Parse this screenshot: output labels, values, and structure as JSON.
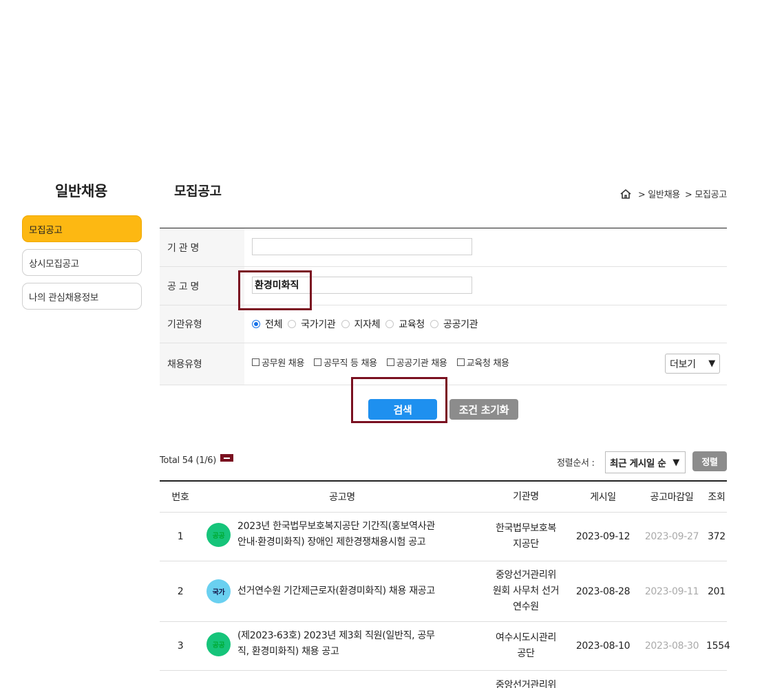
{
  "sidebar": {
    "title": "일반채용",
    "items": [
      {
        "label": "모집공고",
        "active": true
      },
      {
        "label": "상시모집공고",
        "active": false
      },
      {
        "label": "나의 관심채용정보",
        "active": false
      }
    ]
  },
  "page": {
    "title": "모집공고",
    "breadcrumb": [
      "> 일반채용",
      "> 모집공고"
    ]
  },
  "form": {
    "org_label": "기 관 명",
    "org_value": "",
    "notice_label": "공 고 명",
    "notice_value": "환경미화직",
    "org_type_label": "기관유형",
    "org_types": [
      "전체",
      "국가기관",
      "지자체",
      "교육청",
      "공공기관"
    ],
    "org_type_selected": "전체",
    "hire_type_label": "채용유형",
    "hire_types": [
      "공무원 채용",
      "공무직 등 채용",
      "공공기관 채용",
      "교육청 채용"
    ],
    "more_label": "더보기",
    "search_label": "검색",
    "reset_label": "조건 초기화"
  },
  "list": {
    "total": "Total 54 (1/6)",
    "sort_label": "정렬순서 :",
    "sort_value": "최근 게시일 순",
    "sort_button": "정렬",
    "headers": [
      "번호",
      "공고명",
      "기관명",
      "게시일",
      "공고마감일",
      "조회"
    ],
    "rows": [
      {
        "no": "1",
        "badge": "공공",
        "title": "2023년 한국법무보호복지공단 기간직(홍보역사관 안내·환경미화직) 장애인 제한경쟁채용시험 공고",
        "title_l1": "2023년 한국법무보호복지공단 기간직(홍보역사관",
        "title_l2": "안내·환경미화직) 장애인 제한경쟁채용시험 공고",
        "org_l1": "한국법무보호복",
        "org_l2": "지공단",
        "org_l3": "",
        "posted": "2023-09-12",
        "due": "2023-09-27",
        "views": "372"
      },
      {
        "no": "2",
        "badge": "국가",
        "title_l1": "선거연수원 기간제근로자(환경미화직) 채용 재공고",
        "title_l2": "",
        "org_l1": "중앙선거관리위",
        "org_l2": "원회 사무처 선거",
        "org_l3": "연수원",
        "posted": "2023-08-28",
        "due": "2023-09-11",
        "views": "201"
      },
      {
        "no": "3",
        "badge": "공공",
        "title_l1": "(제2023-63호) 2023년 제3회 직원(일반직, 공무",
        "title_l2": "직, 환경미화직) 채용 공고",
        "org_l1": "여수시도시관리",
        "org_l2": "공단",
        "org_l3": "",
        "posted": "2023-08-10",
        "due": "2023-08-30",
        "views": "1554"
      },
      {
        "no": "",
        "badge": "",
        "title_l1": "",
        "title_l2": "",
        "org_l1": "중앙선거관리위",
        "org_l2": "",
        "org_l3": "",
        "posted": "",
        "due": "",
        "views": ""
      }
    ]
  }
}
